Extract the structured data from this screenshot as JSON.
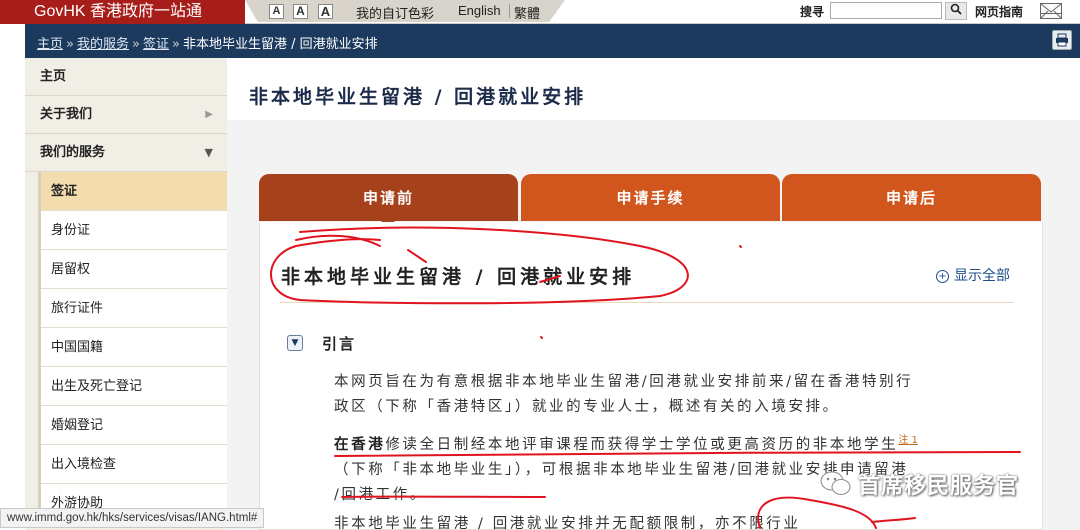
{
  "topbar": {
    "logo": "GovHK 香港政府一站通",
    "font_sizes": [
      "A",
      "A",
      "A"
    ],
    "my_colour": "我的自订色彩",
    "english": "English",
    "traditional": "繁體",
    "search_label": "搜寻",
    "search_placeholder": "",
    "sitemap": "网页指南",
    "icons": {
      "search": "magnifier-icon",
      "mail": "mail-icon"
    }
  },
  "breadcrumb": {
    "items": [
      "主页",
      "我的服务",
      "签证"
    ],
    "current": "非本地毕业生留港 / 回港就业安排"
  },
  "sidebar": {
    "items": [
      {
        "label": "主页"
      },
      {
        "label": "关于我们"
      },
      {
        "label": "我们的服务"
      }
    ],
    "subitems": [
      {
        "label": "签证"
      },
      {
        "label": "身份证"
      },
      {
        "label": "居留权"
      },
      {
        "label": "旅行证件"
      },
      {
        "label": "中国国籍"
      },
      {
        "label": "出生及死亡登记"
      },
      {
        "label": "婚姻登记"
      },
      {
        "label": "出入境检查"
      },
      {
        "label": "外游协助"
      }
    ]
  },
  "main": {
    "title": "非本地毕业生留港 / 回港就业安排",
    "tabs": [
      {
        "label": "申请前"
      },
      {
        "label": "申请手续"
      },
      {
        "label": "申请后"
      }
    ],
    "section_title": "非本地毕业生留港 / 回港就业安排",
    "show_all": "显示全部",
    "intro_title": "引言",
    "para1_line1": "本网页旨在为有意根据非本地毕业生留港/回港就业安排前来/留在香港特别行",
    "para1_line2": "政区（下称「香港特区」）就业的专业人士，概述有关的入境安排。",
    "para2_bold": "在香港",
    "para2_line1_rest": "修读全日制经本地评审课程而获得学士学位或更高资历的非本地学生",
    "para2_note": "注 1",
    "para2_line2": "（下称「非本地毕业生」），可根据非本地毕业生留港/回港就业安排申请留港",
    "para2_line3": "/回港工作。",
    "para3_line1": "非本地毕业生留港 / 回港就业安排并无配额限制，亦不限行业"
  },
  "statusbar": "www.immd.gov.hk/hks/services/visas/IANG.html#",
  "watermark": "首席移民服务官",
  "colors": {
    "brand_red": "#a71d1a",
    "nav_blue": "#1c3a5e",
    "tab_active": "#a6421b",
    "tab_inactive": "#d0561d",
    "annotation_red": "#e0141e"
  }
}
